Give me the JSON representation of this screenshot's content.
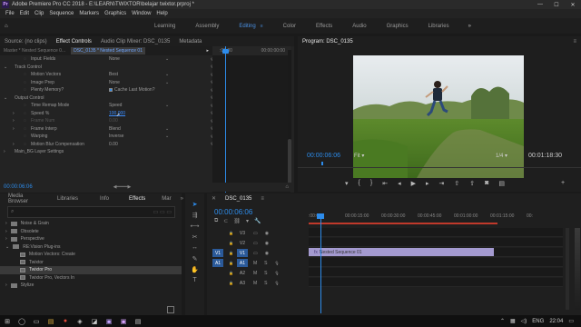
{
  "window": {
    "title": "Adobe Premiere Pro CC 2018 - E:\\LEARN\\TWIXTOR\\belajar twixtor.prproj *",
    "app_icon": "Pr"
  },
  "menu": [
    "File",
    "Edit",
    "Clip",
    "Sequence",
    "Markers",
    "Graphics",
    "Window",
    "Help"
  ],
  "workspaces": [
    {
      "label": "Learning"
    },
    {
      "label": "Assembly"
    },
    {
      "label": "Editing",
      "active": true
    },
    {
      "label": "Color"
    },
    {
      "label": "Effects"
    },
    {
      "label": "Audio"
    },
    {
      "label": "Graphics"
    },
    {
      "label": "Libraries"
    }
  ],
  "source_tabs": [
    "Source: (no clips)",
    "Effect Controls",
    "Audio Clip Mixer: DSC_0135",
    "Metadata"
  ],
  "effect_controls": {
    "header_master": "Master * Nested Sequence 0...",
    "header_clip": "DSC_0135 * Nested Sequence 01",
    "ruler_start": ":00:00",
    "ruler_end": "00:00:00:00",
    "timecode": "00:00:06:06",
    "rows": [
      {
        "label": "Input: Fields",
        "value": "None",
        "indent": 2,
        "dropdown": true
      },
      {
        "label": "Track Control",
        "indent": 1,
        "toggle": "open"
      },
      {
        "label": "Motion Vectors",
        "value": "Best",
        "indent": 2,
        "dropdown": true
      },
      {
        "label": "Image Prep",
        "value": "None",
        "indent": 2,
        "dropdown": true
      },
      {
        "label": "Plenty Memory?",
        "value": "Cache Last Motion?",
        "indent": 2,
        "checkbox": true
      },
      {
        "label": "Output Control",
        "indent": 1,
        "toggle": "open"
      },
      {
        "label": "Time Remap Mode",
        "value": "Speed",
        "indent": 2,
        "dropdown": true
      },
      {
        "label": "Speed %",
        "value": "100.000",
        "indent": 2,
        "toggle": "closed",
        "highlight": true
      },
      {
        "label": "Frame Num",
        "value": "0.00",
        "indent": 2,
        "toggle": "closed",
        "dim": true
      },
      {
        "label": "Frame Interp",
        "value": "Blend",
        "indent": 2,
        "toggle": "closed",
        "dropdown": true
      },
      {
        "label": "Warping",
        "value": "Inverse",
        "indent": 2,
        "dropdown": true
      },
      {
        "label": "Motion Blur Compensation",
        "value": "0.00",
        "indent": 2,
        "toggle": "closed"
      },
      {
        "label": "Main_BG Layer Settings",
        "indent": 1,
        "toggle": "closed"
      }
    ]
  },
  "program": {
    "title": "Program: DSC_0135",
    "timecode": "00:00:06:06",
    "fit": "Fit",
    "ratio": "1/4",
    "duration": "00:01:18:30"
  },
  "effects_panel": {
    "tabs": [
      "Media Browser",
      "Libraries",
      "Info",
      "Effects",
      "Mar"
    ],
    "active_tab": "Effects",
    "tree": [
      {
        "label": "Noise & Grain",
        "type": "folder",
        "indent": 0
      },
      {
        "label": "Obsolete",
        "type": "folder",
        "indent": 0
      },
      {
        "label": "Perspective",
        "type": "folder",
        "indent": 0
      },
      {
        "label": "RE:Vision Plug-ins",
        "type": "folder",
        "indent": 0,
        "open": true
      },
      {
        "label": "Motion Vectors: Create",
        "type": "effect",
        "indent": 1
      },
      {
        "label": "Twixtor",
        "type": "effect",
        "indent": 1
      },
      {
        "label": "Twixtor Pro",
        "type": "effect",
        "indent": 1,
        "selected": true
      },
      {
        "label": "Twixtor Pro, Vectors In",
        "type": "effect",
        "indent": 1
      },
      {
        "label": "Stylize",
        "type": "folder",
        "indent": 0
      }
    ]
  },
  "timeline": {
    "sequence": "DSC_0135",
    "timecode": "00:00:06:06",
    "ruler": [
      ":00:00",
      "00:00:15:00",
      "00:00:30:00",
      "00:00:45:00",
      "00:01:00:00",
      "00:01:15:00",
      "00:"
    ],
    "tracks": [
      {
        "src": "",
        "name": "V3"
      },
      {
        "src": "",
        "name": "V2"
      },
      {
        "src": "V1",
        "name": "V1"
      },
      {
        "src": "A1",
        "name": "A1"
      },
      {
        "src": "",
        "name": "A2"
      },
      {
        "src": "",
        "name": "A3"
      }
    ],
    "clip_label": "Nested Sequence 01"
  },
  "taskbar": {
    "time": "22:04",
    "lang": "ENG"
  },
  "colors": {
    "accent": "#2d8ceb",
    "bg": "#1a1a1a"
  }
}
